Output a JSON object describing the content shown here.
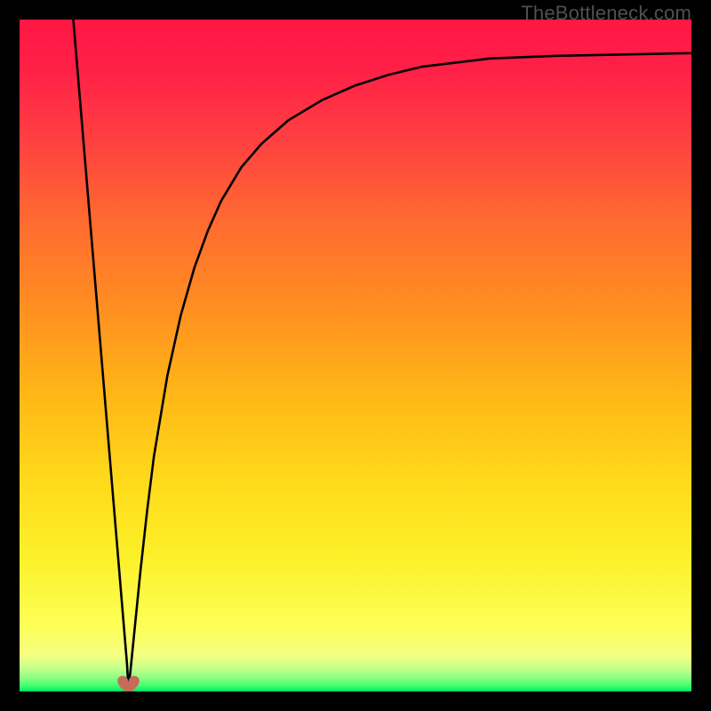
{
  "watermark": {
    "text": "TheBottleneck.com"
  },
  "chart_data": {
    "type": "line",
    "title": "",
    "xlabel": "",
    "ylabel": "",
    "xlim": [
      0,
      10
    ],
    "ylim": [
      0,
      100
    ],
    "legend": false,
    "grid": false,
    "background_gradient": {
      "stops": [
        {
          "offset": 0.0,
          "color": "#ff1744"
        },
        {
          "offset": 0.07,
          "color": "#ff1f47"
        },
        {
          "offset": 0.18,
          "color": "#ff4040"
        },
        {
          "offset": 0.3,
          "color": "#ff6a30"
        },
        {
          "offset": 0.43,
          "color": "#ff8f20"
        },
        {
          "offset": 0.56,
          "color": "#ffb716"
        },
        {
          "offset": 0.68,
          "color": "#ffd81a"
        },
        {
          "offset": 0.8,
          "color": "#fcf029"
        },
        {
          "offset": 0.9,
          "color": "#fdff55"
        },
        {
          "offset": 0.945,
          "color": "#f5ff80"
        },
        {
          "offset": 0.965,
          "color": "#c8ff8c"
        },
        {
          "offset": 0.98,
          "color": "#8bff80"
        },
        {
          "offset": 0.992,
          "color": "#3dff70"
        },
        {
          "offset": 1.0,
          "color": "#00e562"
        }
      ]
    },
    "marker": {
      "x": 1.62,
      "y": 1.0,
      "shape": "heart",
      "color": "#c76a5a"
    },
    "series": [
      {
        "name": "bottleneck-curve",
        "x": [
          0.8,
          0.9,
          1.0,
          1.1,
          1.2,
          1.3,
          1.4,
          1.5,
          1.55,
          1.6,
          1.62,
          1.65,
          1.7,
          1.8,
          1.9,
          2.0,
          2.2,
          2.4,
          2.6,
          2.8,
          3.0,
          3.3,
          3.6,
          4.0,
          4.5,
          5.0,
          5.5,
          6.0,
          7.0,
          8.0,
          9.0,
          10.0
        ],
        "y": [
          100.0,
          88.0,
          76.0,
          64.0,
          52.0,
          40.0,
          28.0,
          16.0,
          10.0,
          4.0,
          0.5,
          3.0,
          8.0,
          18.0,
          27.0,
          35.0,
          47.0,
          56.0,
          63.0,
          68.5,
          73.0,
          78.0,
          81.5,
          85.0,
          88.0,
          90.2,
          91.8,
          93.0,
          94.2,
          94.6,
          94.8,
          95.0
        ]
      }
    ]
  }
}
